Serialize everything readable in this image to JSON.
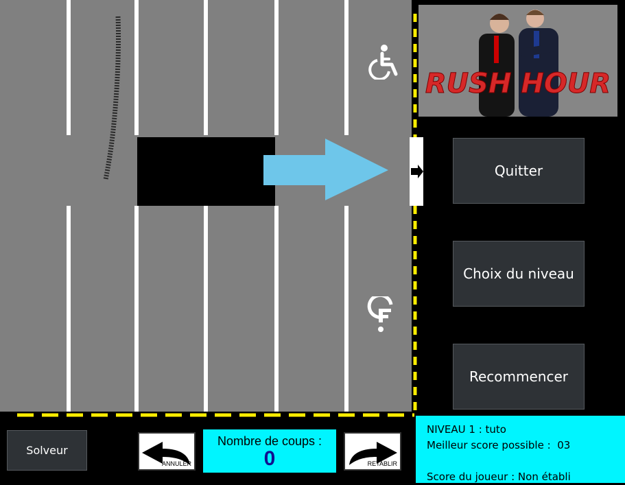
{
  "board": {
    "name": "parking-grid"
  },
  "banner": {
    "title": "RUSH HOUR"
  },
  "menu": {
    "quit": "Quitter",
    "level_choice": "Choix du niveau",
    "restart": "Recommencer"
  },
  "controls": {
    "solver": "Solveur",
    "undo": "ANNULER",
    "redo": "RETABLIR"
  },
  "counter": {
    "label": "Nombre de coups :",
    "value": "0"
  },
  "info": {
    "level": "NIVEAU 1 : tuto",
    "best_score": "Meilleur score possible :  03",
    "player_score": "Score du joueur : Non établi"
  },
  "icons": {
    "accessibility": "wheelchair-icon",
    "hint": "hint-icon"
  },
  "colors": {
    "board": "#808080",
    "arrow": "#6ec6ea",
    "panel": "#00f5ff",
    "border_dash": "#ffee00"
  }
}
